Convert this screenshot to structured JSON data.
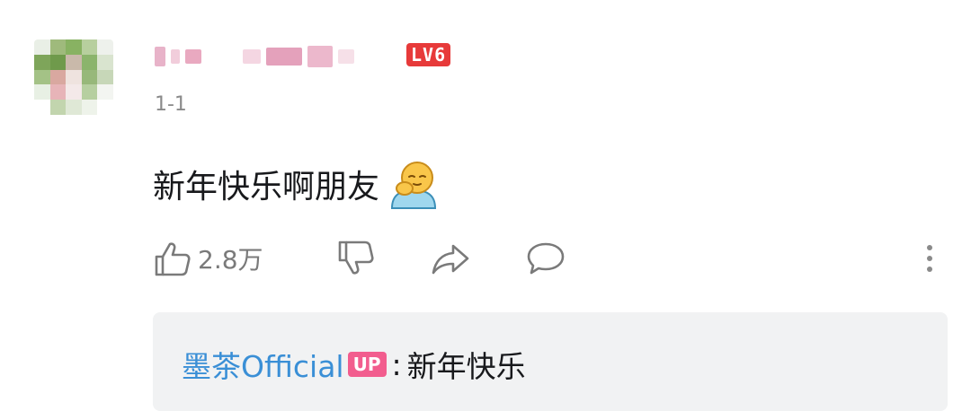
{
  "comment": {
    "username": "",
    "level_badge": "LV6",
    "floor": "1-1",
    "text": "新年快乐啊朋友",
    "emoji_name": "hug-emoji",
    "like_count": "2.8万"
  },
  "reply": {
    "username": "墨茶Official",
    "badge": "UP",
    "colon": ":",
    "text": "新年快乐"
  },
  "colors": {
    "level_badge_bg": "#e73a3a",
    "up_badge_bg": "#f25d8e",
    "reply_user": "#3a8fd6",
    "reply_box_bg": "#f1f2f3",
    "icon_gray": "#7a7a7a"
  },
  "icons": [
    "thumbs-up-icon",
    "thumbs-down-icon",
    "share-icon",
    "reply-icon",
    "more-vertical-icon"
  ]
}
